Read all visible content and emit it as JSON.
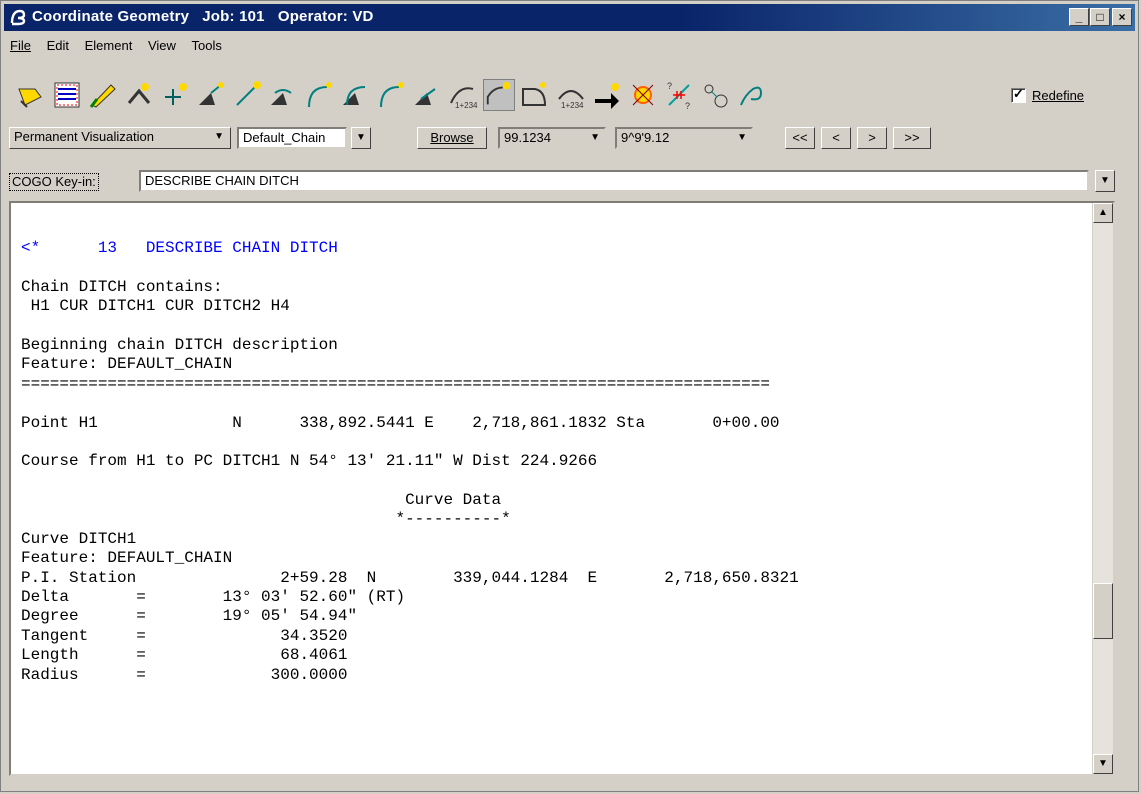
{
  "window": {
    "title": "Coordinate Geometry   Job: 101   Operator: VD",
    "controls": [
      "minimize",
      "maximize",
      "close"
    ]
  },
  "menu": [
    "File",
    "Edit",
    "Element",
    "View",
    "Tools"
  ],
  "toolbar": {
    "icons": [
      "select-point-icon",
      "point-list-icon",
      "edit-icon",
      "store-point-icon",
      "locate-point-icon",
      "traverse-angle-icon",
      "traverse-line-icon",
      "curve-arc-icon",
      "curve-pc-icon",
      "curve-tangent-icon",
      "curve-offset-icon",
      "curve-pi-icon",
      "station-offset-icon",
      "chain-icon",
      "polygon-icon",
      "profile-station-icon",
      "arrow-transfer-icon",
      "intersect-icon",
      "inverse-icon",
      "radial-icon",
      "spiral-icon"
    ],
    "redefine_label": "Redefine",
    "redefine_checked": true
  },
  "controls_row": {
    "visualization": "Permanent Visualization",
    "chain": "Default_Chain",
    "browse_label": "Browse",
    "value1": "99.1234",
    "value2": "9^9'9.12",
    "nav": [
      "<<",
      "<",
      ">",
      ">>"
    ]
  },
  "keyin": {
    "label": "COGO Key-in:",
    "value": "DESCRIBE CHAIN DITCH"
  },
  "output": {
    "highlight_color": "#0000ff",
    "lines": [
      {
        "text": "<*      13   DESCRIBE CHAIN DITCH",
        "color": "blue"
      },
      {
        "text": ""
      },
      {
        "text": "Chain DITCH contains:"
      },
      {
        "text": " H1 CUR DITCH1 CUR DITCH2 H4"
      },
      {
        "text": ""
      },
      {
        "text": "Beginning chain DITCH description"
      },
      {
        "text": "Feature: DEFAULT_CHAIN"
      },
      {
        "text": "=============================================================================="
      },
      {
        "text": ""
      },
      {
        "text": "Point H1              N      338,892.5441 E    2,718,861.1832 Sta       0+00.00"
      },
      {
        "text": ""
      },
      {
        "text": "Course from H1 to PC DITCH1 N 54° 13' 21.11\" W Dist 224.9266"
      },
      {
        "text": ""
      },
      {
        "text": "                                        Curve Data"
      },
      {
        "text": "                                       *----------*"
      },
      {
        "text": "Curve DITCH1"
      },
      {
        "text": "Feature: DEFAULT_CHAIN"
      },
      {
        "text": "P.I. Station               2+59.28  N        339,044.1284  E       2,718,650.8321"
      },
      {
        "text": "Delta       =        13° 03' 52.60\" (RT)"
      },
      {
        "text": "Degree      =        19° 05' 54.94\""
      },
      {
        "text": "Tangent     =              34.3520"
      },
      {
        "text": "Length      =              68.4061"
      },
      {
        "text": "Radius      =             300.0000"
      }
    ]
  }
}
